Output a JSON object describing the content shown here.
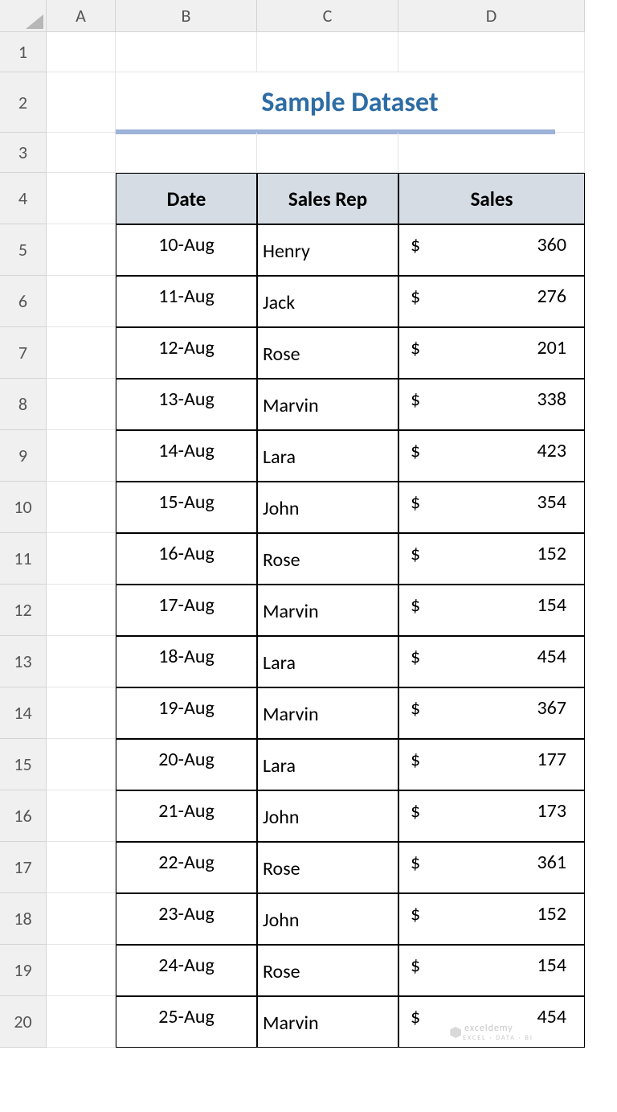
{
  "columns": [
    "A",
    "B",
    "C",
    "D"
  ],
  "rows": [
    "1",
    "2",
    "3",
    "4",
    "5",
    "6",
    "7",
    "8",
    "9",
    "10",
    "11",
    "12",
    "13",
    "14",
    "15",
    "16",
    "17",
    "18",
    "19",
    "20"
  ],
  "title": "Sample Dataset",
  "headers": {
    "c1": "Date",
    "c2": "Sales Rep",
    "c3": "Sales"
  },
  "currency": "$",
  "data": [
    {
      "date": "10-Aug",
      "rep": "Henry",
      "sales": "360"
    },
    {
      "date": "11-Aug",
      "rep": "Jack",
      "sales": "276"
    },
    {
      "date": "12-Aug",
      "rep": "Rose",
      "sales": "201"
    },
    {
      "date": "13-Aug",
      "rep": "Marvin",
      "sales": "338"
    },
    {
      "date": "14-Aug",
      "rep": "Lara",
      "sales": "423"
    },
    {
      "date": "15-Aug",
      "rep": "John",
      "sales": "354"
    },
    {
      "date": "16-Aug",
      "rep": "Rose",
      "sales": "152"
    },
    {
      "date": "17-Aug",
      "rep": "Marvin",
      "sales": "154"
    },
    {
      "date": "18-Aug",
      "rep": "Lara",
      "sales": "454"
    },
    {
      "date": "19-Aug",
      "rep": "Marvin",
      "sales": "367"
    },
    {
      "date": "20-Aug",
      "rep": "Lara",
      "sales": "177"
    },
    {
      "date": "21-Aug",
      "rep": "John",
      "sales": "173"
    },
    {
      "date": "22-Aug",
      "rep": "Rose",
      "sales": "361"
    },
    {
      "date": "23-Aug",
      "rep": "John",
      "sales": "152"
    },
    {
      "date": "24-Aug",
      "rep": "Rose",
      "sales": "154"
    },
    {
      "date": "25-Aug",
      "rep": "Marvin",
      "sales": "454"
    }
  ],
  "watermark": {
    "brand": "exceldemy",
    "sub": "EXCEL · DATA · BI"
  }
}
